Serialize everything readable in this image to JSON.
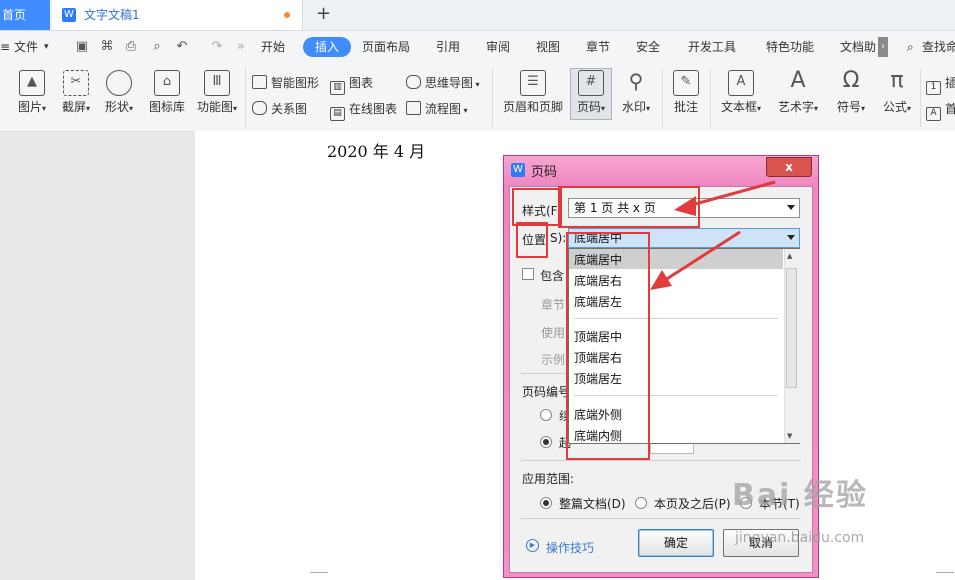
{
  "tabs": {
    "home": "首页",
    "document": "文字文稿1",
    "new_tab": "+"
  },
  "menu": {
    "file": "文件",
    "items": [
      "开始",
      "插入",
      "页面布局",
      "引用",
      "审阅",
      "视图",
      "章节",
      "安全",
      "开发工具",
      "特色功能",
      "文档助"
    ],
    "active": "插入",
    "search": "查找命"
  },
  "ribbon": {
    "picture": "图片",
    "screenshot": "截屏",
    "shape": "形状",
    "icon_library": "图标库",
    "function_chart": "功能图",
    "smart_graphic": "智能图形",
    "chart": "图表",
    "mind_map": "思维导图",
    "relation_chart": "关系图",
    "online_chart": "在线图表",
    "flowchart": "流程图",
    "header_footer": "页眉和页脚",
    "page_number": "页码",
    "watermark": "水印",
    "comment": "批注",
    "text_box": "文本框",
    "art_text": "艺术字",
    "symbol": "符号",
    "formula": "公式",
    "extra_top": "插",
    "extra_bottom": "首"
  },
  "document": {
    "text": "2020 年 4 月"
  },
  "dialog": {
    "title": "页码",
    "close": "x",
    "style_label": "样式(F",
    "style_value": "第 1 页 共 x 页",
    "position_label": "位置",
    "position_label_tail": "S):",
    "position_value": "底端居中",
    "include_label": "包含",
    "chapter_label": "章节",
    "use_label": "使用",
    "example_label": "示例",
    "page_numbering_label": "页码编号",
    "numbering_opt1": "续",
    "numbering_opt2": "起",
    "apply_range_label": "应用范围:",
    "apply_whole": "整篇文档(D)",
    "apply_after": "本页及之后(P)",
    "apply_section": "本节(T)",
    "tips": "操作技巧",
    "ok": "确定",
    "cancel": "取消",
    "dropdown_options": [
      "底端居中",
      "底端居右",
      "底端居左",
      "顶端居中",
      "顶端居右",
      "顶端居左",
      "底端外侧",
      "底端内侧"
    ]
  },
  "watermark": {
    "brand": "Bai 经验",
    "url": "jingyan.baidu.com"
  },
  "colors": {
    "accent": "#3f8cff",
    "dialog_frame": "#ee86c0",
    "annotation": "#e23b3b"
  }
}
